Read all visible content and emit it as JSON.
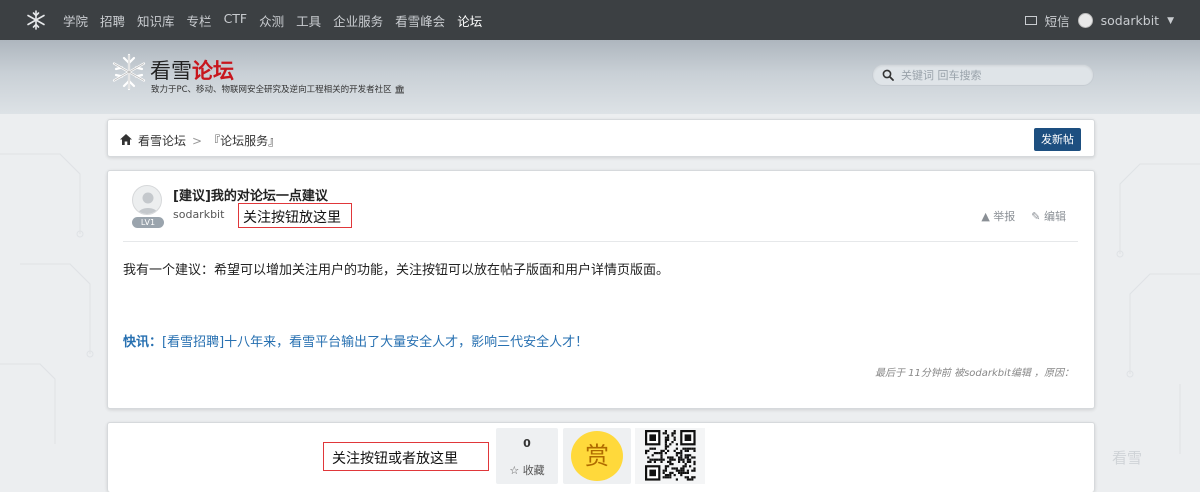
{
  "nav": {
    "links": [
      "学院",
      "招聘",
      "知识库",
      "专栏",
      "CTF",
      "众测",
      "工具",
      "企业服务",
      "看雪峰会",
      "论坛"
    ],
    "active_index": 9,
    "messages_label": "短信",
    "username": "sodarkbit"
  },
  "header": {
    "brand_main": "看雪",
    "brand_accent": "论坛",
    "slogan": "致力于PC、移动、物联网安全研究及逆向工程相关的开发者社区",
    "search_placeholder": "关键词 回车搜索"
  },
  "breadcrumb": {
    "home": "看雪论坛",
    "separator": ">",
    "section": "『论坛服务』",
    "new_post_label": "发新帖"
  },
  "post": {
    "title": "[建议]我的对论坛一点建议",
    "author": "sodarkbit",
    "level_badge": "LV1",
    "annotation": "关注按钮放这里",
    "report_label": "举报",
    "edit_label": "编辑",
    "body": "我有一个建议：希望可以增加关注用户的功能，关注按钮可以放在帖子版面和用户详情页版面。",
    "news_prefix": "快讯：",
    "news_text": "[看雪招聘]十八年来，看雪平台输出了大量安全人才，影响三代安全人才！",
    "meta": "最后于  11分钟前 被sodarkbit编辑 ，原因："
  },
  "actions": {
    "annotation": "关注按钮或者放这里",
    "favorite_count": "0",
    "favorite_label": "收藏",
    "reward_label": "赏"
  },
  "watermark": "看雪",
  "colors": {
    "nav_bg": "#3c4043",
    "brand_accent": "#c8161d",
    "primary_button": "#1d4f80",
    "link": "#2770b1",
    "annotation_border": "#e0373a",
    "reward_circle": "#ffd93b"
  }
}
